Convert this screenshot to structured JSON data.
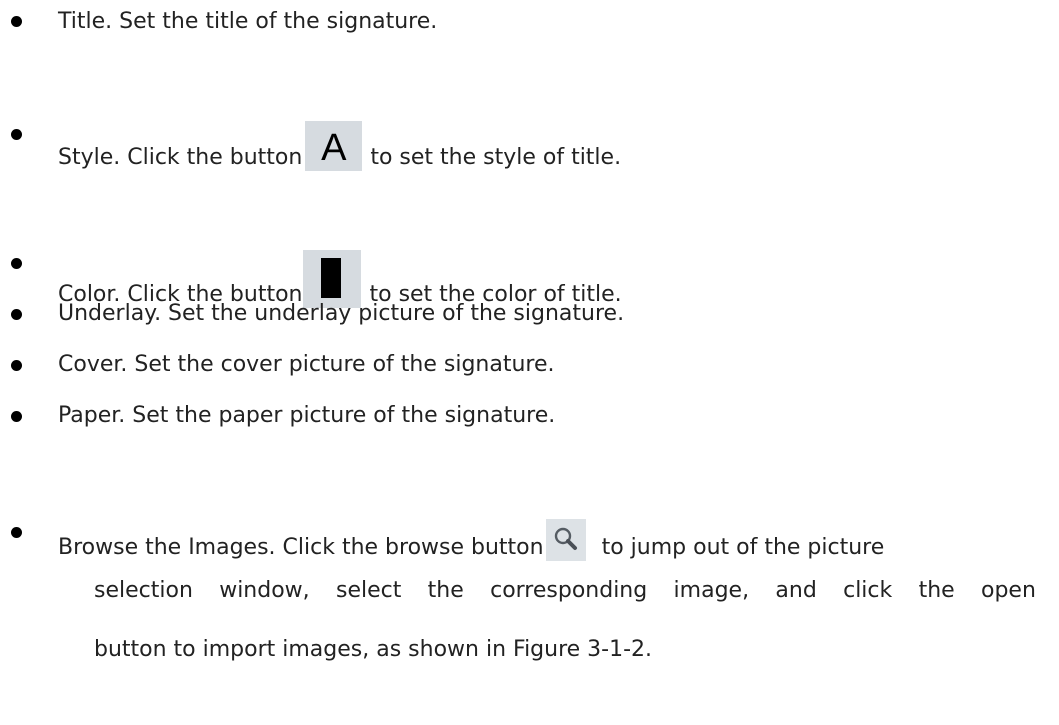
{
  "items": {
    "title": "Title. Set the title of the signature.",
    "style_before": "Style. Click the button",
    "style_icon_glyph": "A",
    "style_after": "to set the style of title.",
    "color_before": "Color. Click the button",
    "color_after": "to set the color of title.",
    "underlay": "Underlay. Set the underlay picture of the signature.",
    "cover": "Cover. Set the cover picture of the signature.",
    "paper": "Paper. Set the paper picture of the signature.",
    "browse_before": "Browse the Images. Click the browse button",
    "browse_after": "to jump out of the picture",
    "browse_line2_words": [
      "selection",
      "window,",
      "select",
      "the",
      "corresponding",
      "image,",
      "and",
      "click",
      "the",
      "open"
    ],
    "browse_line3": "button to import images, as shown in Figure 3-1-2."
  },
  "icons": {
    "style": "font-style-icon",
    "color": "color-swatch-icon",
    "browse": "magnifier-search-icon"
  },
  "colors": {
    "text": "#222222",
    "icon_bg": "#d6dbe0",
    "bullet": "#000000"
  }
}
